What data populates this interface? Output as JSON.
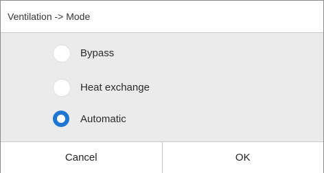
{
  "dialog": {
    "title": "Ventilation -> Mode",
    "options": [
      {
        "label": "Bypass",
        "selected": false
      },
      {
        "label": "Heat exchange",
        "selected": false
      },
      {
        "label": "Automatic",
        "selected": true
      }
    ],
    "buttons": {
      "cancel_label": "Cancel",
      "ok_label": "OK"
    }
  },
  "colors": {
    "accent": "#1f76d2",
    "background": "#ebebeb",
    "surface": "#ffffff"
  }
}
